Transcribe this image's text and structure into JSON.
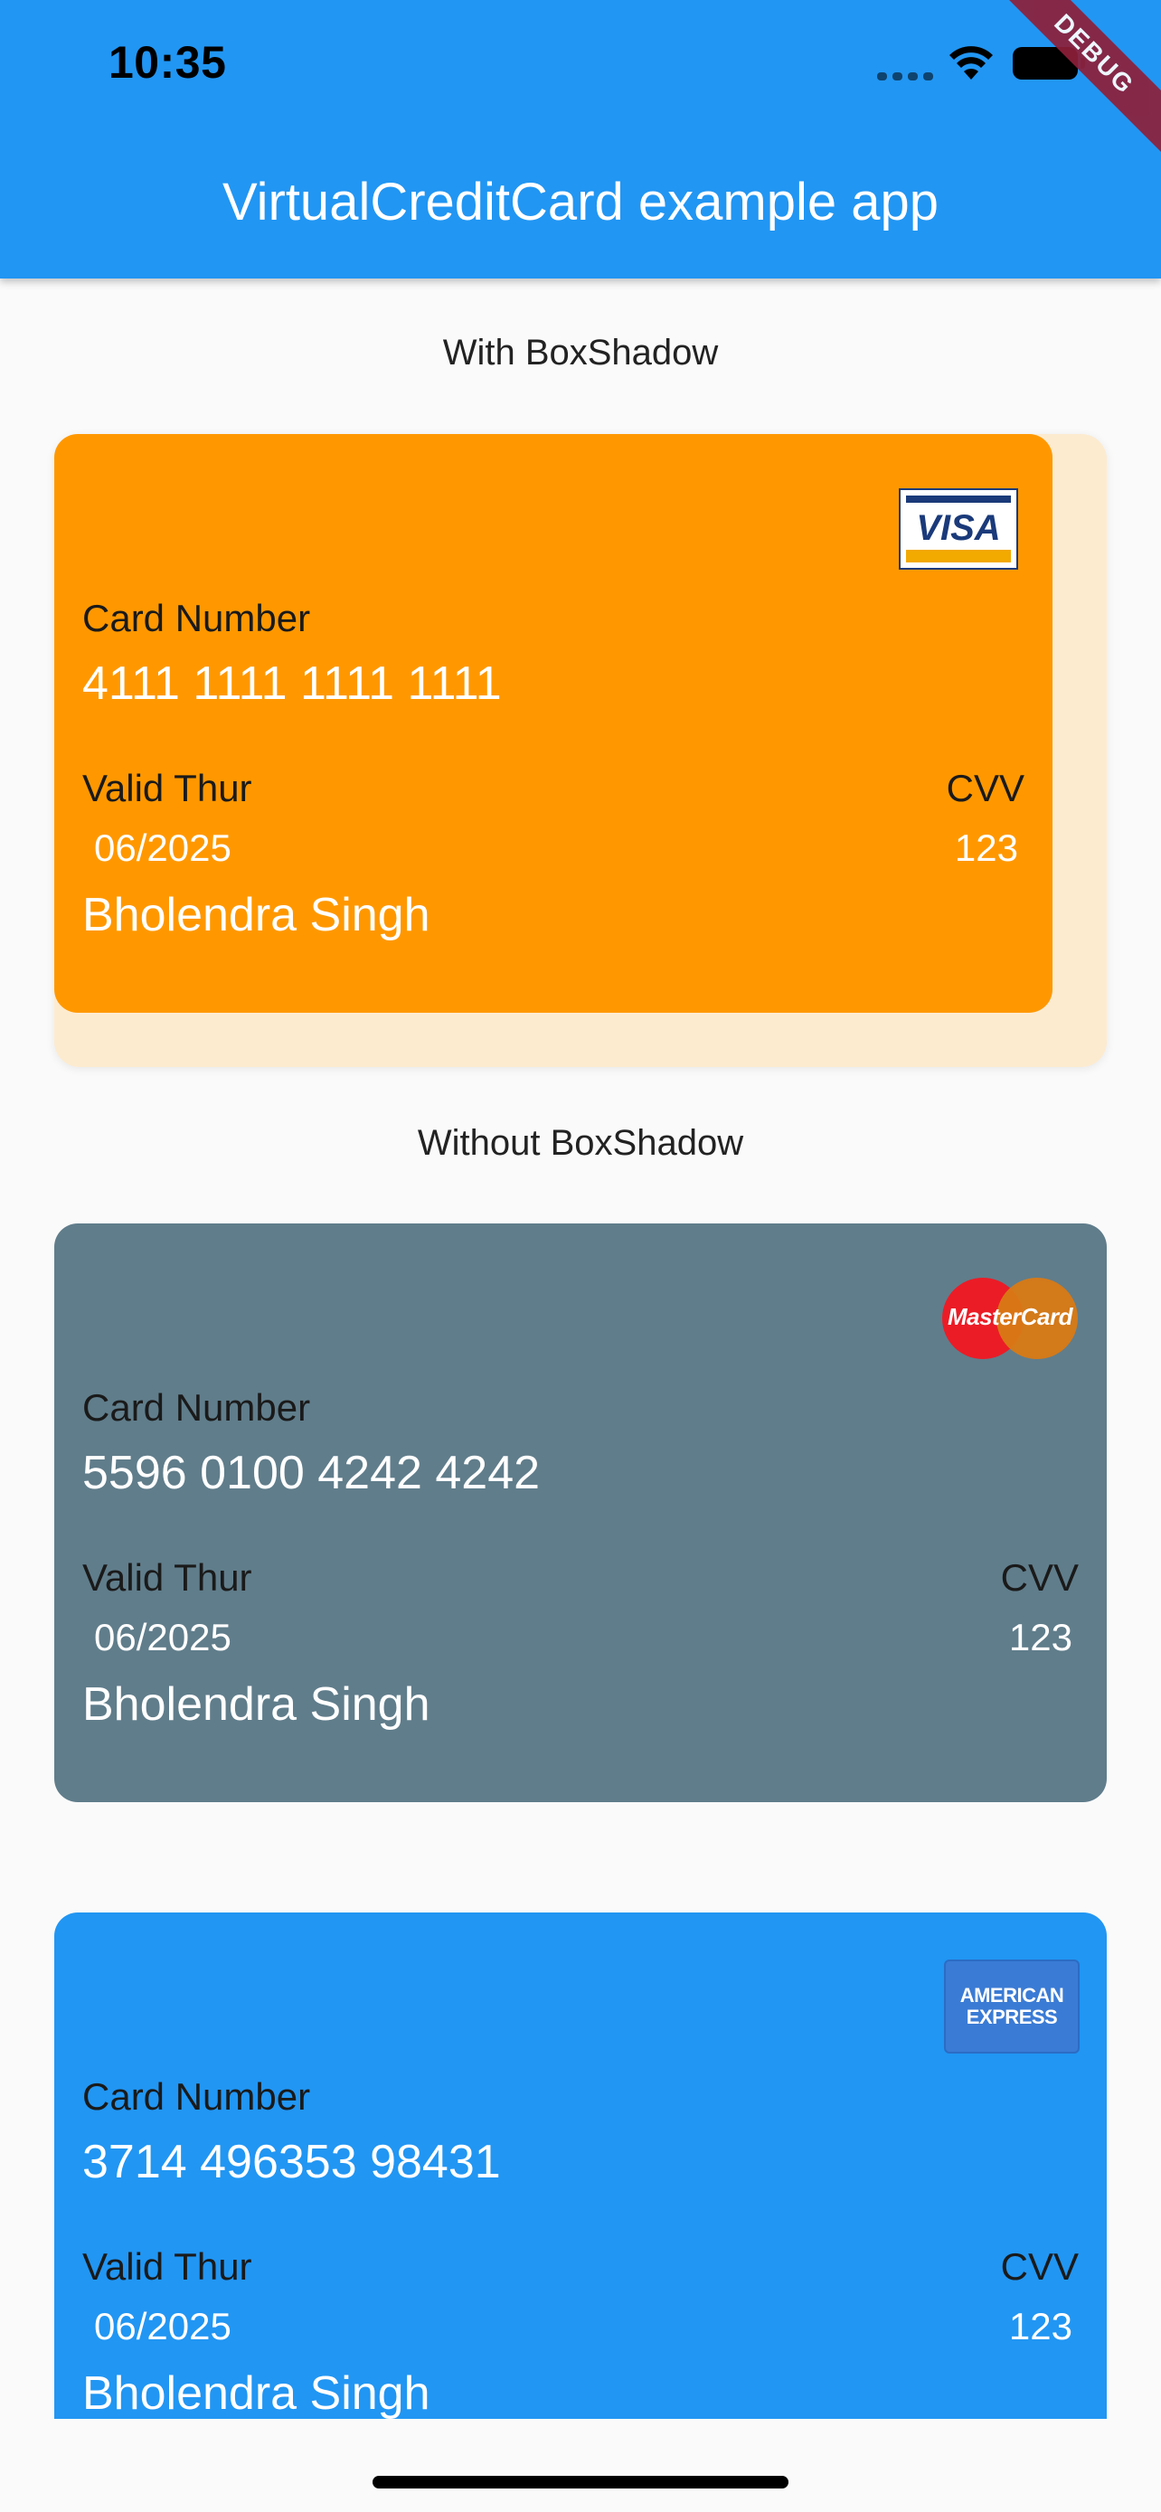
{
  "status_bar": {
    "time": "10:35"
  },
  "app_bar": {
    "title": "VirtualCreditCard example app",
    "debug_banner": "DEBUG"
  },
  "sections": {
    "with_shadow": "With BoxShadow",
    "without_shadow": "Without BoxShadow"
  },
  "cards": [
    {
      "brand": "VISA",
      "color": "#ff9800",
      "card_number_label": "Card Number",
      "card_number": "4111 1111 1111 1111",
      "valid_label": "Valid Thur",
      "valid": "06/2025",
      "cvv_label": "CVV",
      "cvv": "123",
      "holder": "Bholendra Singh"
    },
    {
      "brand": "MasterCard",
      "color": "#607d8b",
      "card_number_label": "Card Number",
      "card_number": "5596 0100 4242 4242",
      "valid_label": "Valid Thur",
      "valid": "06/2025",
      "cvv_label": "CVV",
      "cvv": "123",
      "holder": "Bholendra Singh"
    },
    {
      "brand_lines": [
        "AMERICAN",
        "EXPRESS"
      ],
      "color": "#2196f3",
      "card_number_label": "Card Number",
      "card_number": "3714 496353 98431",
      "valid_label": "Valid Thur",
      "valid": "06/2025",
      "cvv_label": "CVV",
      "cvv": "123",
      "holder": "Bholendra Singh"
    }
  ]
}
